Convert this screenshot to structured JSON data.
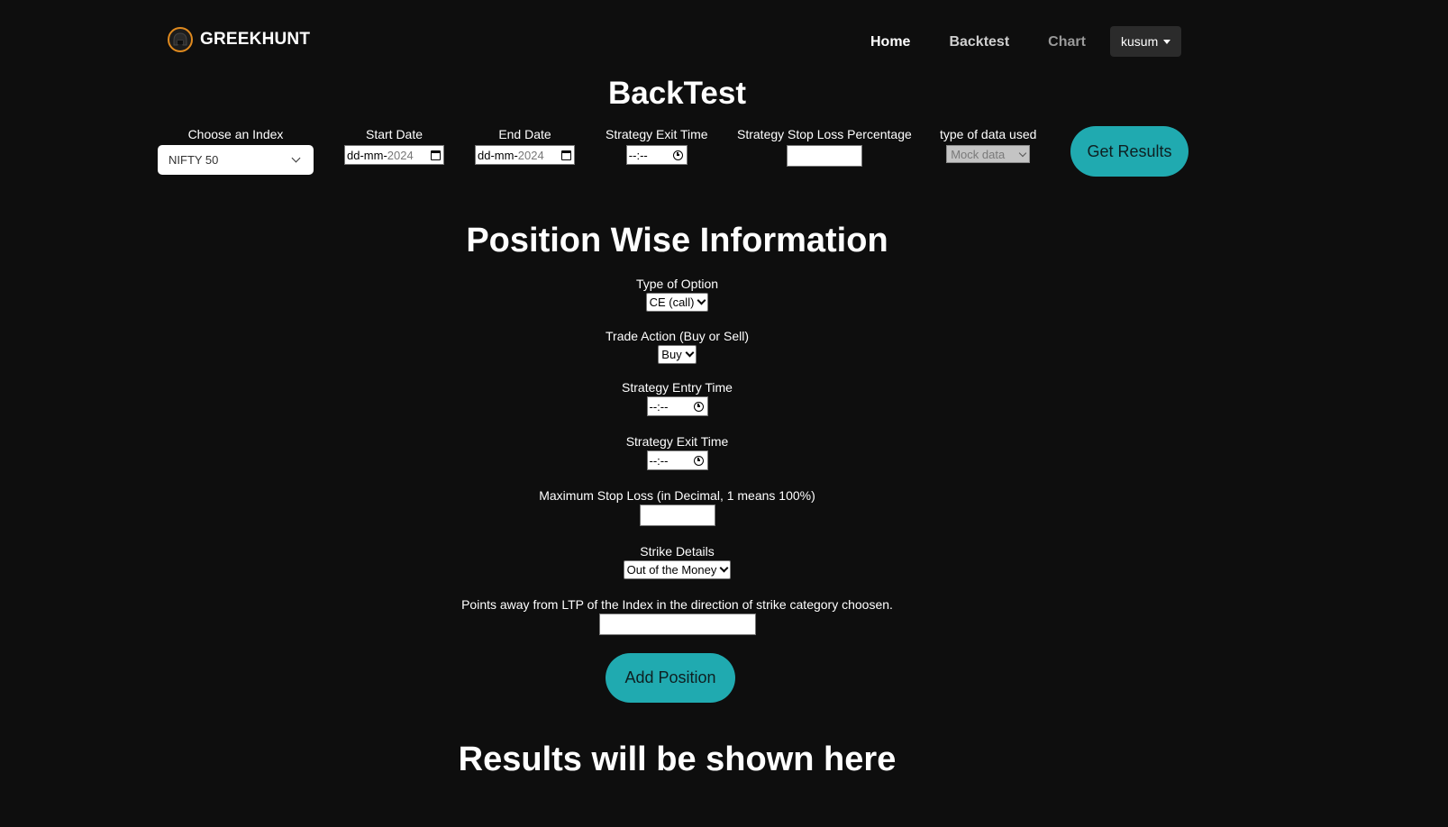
{
  "brand": {
    "name": "GREEKHUNT",
    "logo_icon": "helmet-logo-icon"
  },
  "nav": {
    "home": "Home",
    "backtest": "Backtest",
    "chart": "Chart",
    "user": "kusum"
  },
  "backtest": {
    "title": "BackTest",
    "index_label": "Choose an Index",
    "index_value": "NIFTY 50",
    "start_date_label": "Start Date",
    "start_date_prefix": "dd-mm-",
    "start_date_year": "2024",
    "end_date_label": "End Date",
    "end_date_prefix": "dd-mm-",
    "end_date_year": "2024",
    "exit_time_label": "Strategy Exit Time",
    "exit_time_value": "--:--",
    "stop_loss_label": "Strategy Stop Loss Percentage",
    "stop_loss_value": "",
    "data_type_label": "type of data used",
    "data_type_value": "Mock data",
    "get_results_label": "Get Results"
  },
  "position": {
    "title": "Position Wise Information",
    "option_type_label": "Type of Option",
    "option_type_value": "CE (call)",
    "trade_action_label": "Trade Action (Buy or Sell)",
    "trade_action_value": "Buy",
    "entry_time_label": "Strategy Entry Time",
    "entry_time_value": "--:--",
    "exit_time_label": "Strategy Exit Time",
    "exit_time_value": "--:--",
    "max_stop_loss_label": "Maximum Stop Loss (in Decimal, 1 means 100%)",
    "max_stop_loss_value": "",
    "strike_details_label": "Strike Details",
    "strike_details_value": "Out of the Money",
    "points_away_label": "Points away from LTP of the Index in the direction of strike category choosen.",
    "points_away_value": "",
    "add_position_label": "Add Position"
  },
  "results": {
    "title": "Results will be shown here"
  },
  "colors": {
    "background": "#0e0e0e",
    "accent": "#20aab0",
    "user_menu_bg": "#2b2b2b"
  }
}
